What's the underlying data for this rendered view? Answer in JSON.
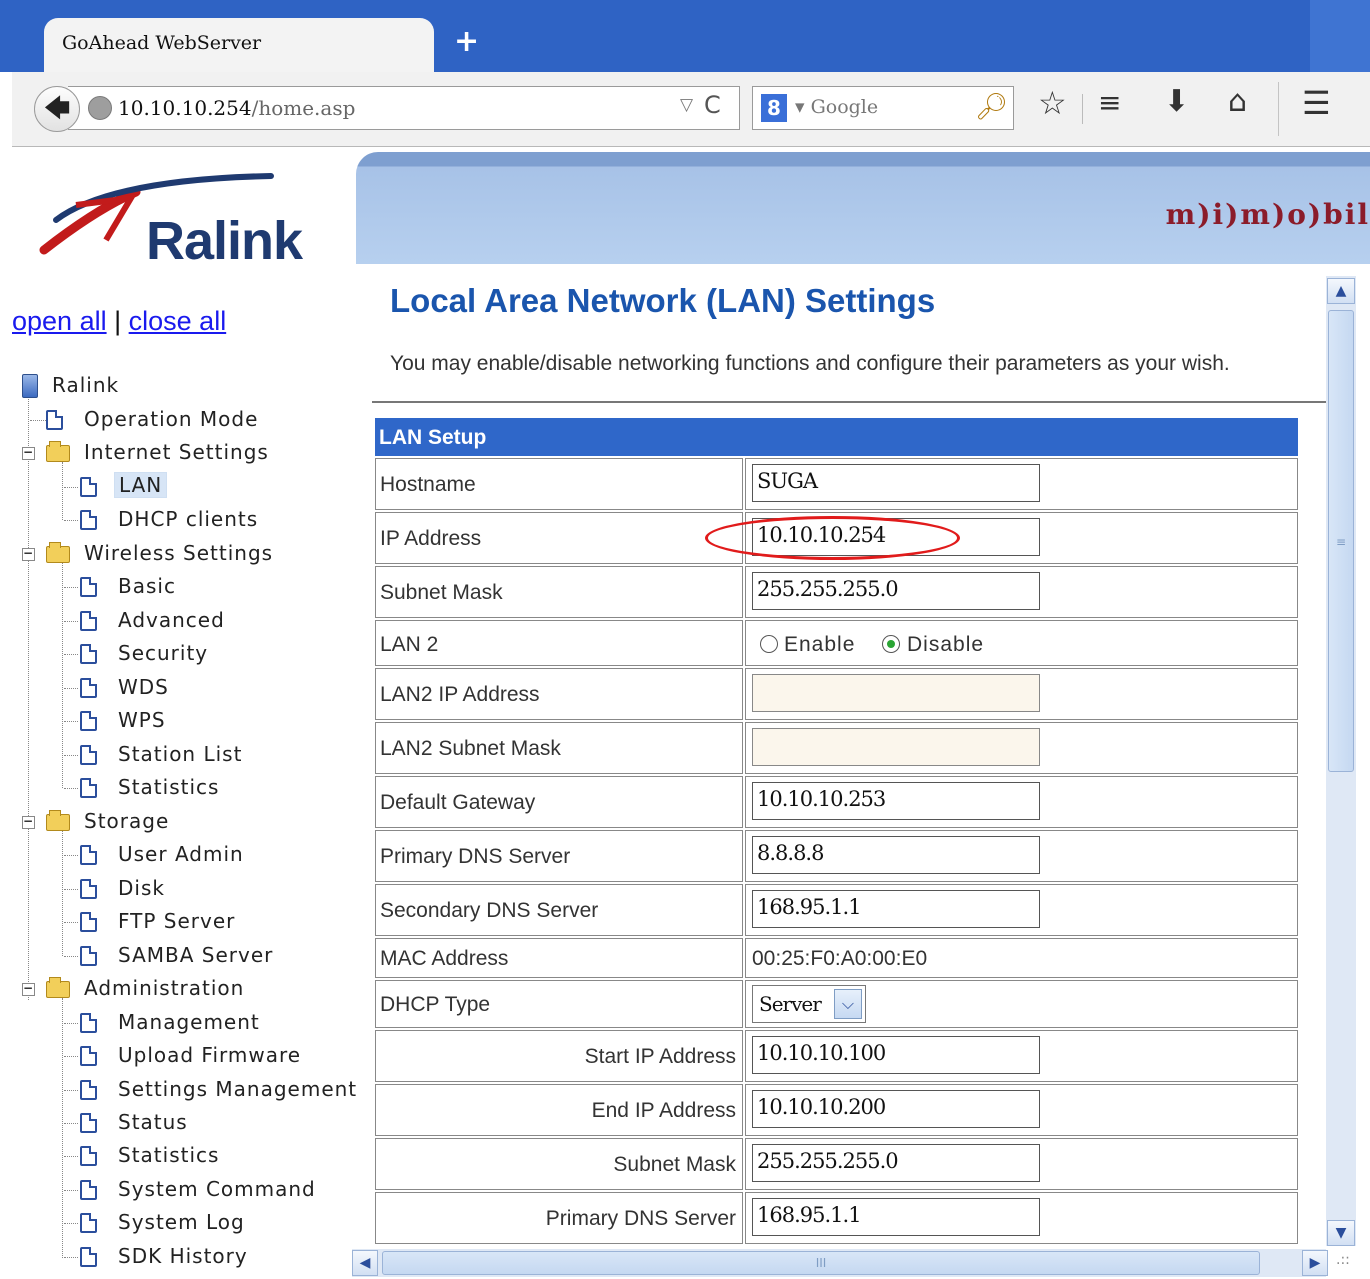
{
  "browser": {
    "tab_title": "GoAhead WebServer",
    "new_tab_icon": "plus-icon",
    "url_host": "10.10.10.254",
    "url_path": "/home.asp",
    "search_engine_icon": "google-icon",
    "search_placeholder": "Google",
    "toolbar_icons": [
      "bookmark-star-icon",
      "reading-list-icon",
      "download-icon",
      "home-icon",
      "menu-icon"
    ]
  },
  "header": {
    "logo_text": "Ralink",
    "banner_brand": "m)i)m)o)bil"
  },
  "sidebar": {
    "open_all": "open all",
    "separator": "|",
    "close_all": "close all",
    "tree": [
      {
        "label": "Ralink",
        "type": "root"
      },
      {
        "label": "Operation Mode",
        "type": "page"
      },
      {
        "label": "Internet Settings",
        "type": "folder"
      },
      {
        "label": "LAN",
        "type": "page",
        "selected": true
      },
      {
        "label": "DHCP clients",
        "type": "page"
      },
      {
        "label": "Wireless Settings",
        "type": "folder"
      },
      {
        "label": "Basic",
        "type": "page"
      },
      {
        "label": "Advanced",
        "type": "page"
      },
      {
        "label": "Security",
        "type": "page"
      },
      {
        "label": "WDS",
        "type": "page"
      },
      {
        "label": "WPS",
        "type": "page"
      },
      {
        "label": "Station List",
        "type": "page"
      },
      {
        "label": "Statistics",
        "type": "page"
      },
      {
        "label": "Storage",
        "type": "folder"
      },
      {
        "label": "User Admin",
        "type": "page"
      },
      {
        "label": "Disk",
        "type": "page"
      },
      {
        "label": "FTP Server",
        "type": "page"
      },
      {
        "label": "SAMBA Server",
        "type": "page"
      },
      {
        "label": "Administration",
        "type": "folder"
      },
      {
        "label": "Management",
        "type": "page"
      },
      {
        "label": "Upload Firmware",
        "type": "page"
      },
      {
        "label": "Settings Management",
        "type": "page"
      },
      {
        "label": "Status",
        "type": "page"
      },
      {
        "label": "Statistics",
        "type": "page"
      },
      {
        "label": "System Command",
        "type": "page"
      },
      {
        "label": "System Log",
        "type": "page"
      },
      {
        "label": "SDK History",
        "type": "page"
      }
    ]
  },
  "main": {
    "title": "Local Area Network (LAN) Settings",
    "description": "You may enable/disable networking functions and configure their parameters as your wish.",
    "section_title": "LAN Setup",
    "fields": {
      "hostname": {
        "label": "Hostname",
        "value": "SUGA"
      },
      "ip_address": {
        "label": "IP Address",
        "value": "10.10.10.254"
      },
      "subnet_mask": {
        "label": "Subnet Mask",
        "value": "255.255.255.0"
      },
      "lan2": {
        "label": "LAN 2",
        "enable": "Enable",
        "disable": "Disable",
        "selected": "Disable"
      },
      "lan2_ip": {
        "label": "LAN2 IP Address",
        "value": ""
      },
      "lan2_mask": {
        "label": "LAN2 Subnet Mask",
        "value": ""
      },
      "gateway": {
        "label": "Default Gateway",
        "value": "10.10.10.253"
      },
      "primary_dns": {
        "label": "Primary DNS Server",
        "value": "8.8.8.8"
      },
      "secondary_dns": {
        "label": "Secondary DNS Server",
        "value": "168.95.1.1"
      },
      "mac": {
        "label": "MAC Address",
        "value": "00:25:F0:A0:00:E0"
      },
      "dhcp_type": {
        "label": "DHCP Type",
        "value": "Server"
      },
      "start_ip": {
        "label": "Start IP Address",
        "value": "10.10.10.100"
      },
      "end_ip": {
        "label": "End IP Address",
        "value": "10.10.10.200"
      },
      "dhcp_mask": {
        "label": "Subnet Mask",
        "value": "255.255.255.0"
      },
      "dhcp_primary_dns": {
        "label": "Primary DNS Server",
        "value": "168.95.1.1"
      }
    }
  },
  "annotation_color": "#e11b1b"
}
